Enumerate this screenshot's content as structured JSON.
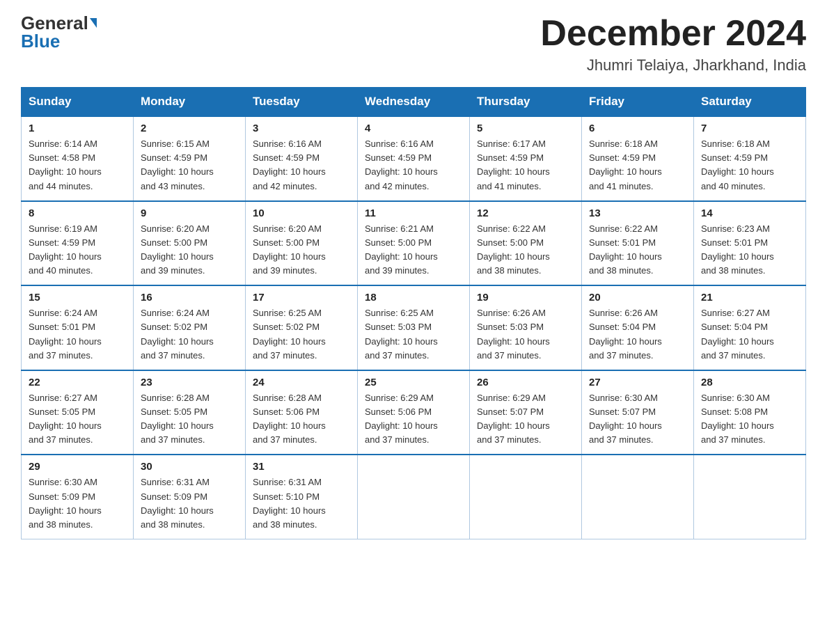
{
  "header": {
    "logo_general": "General",
    "logo_blue": "Blue",
    "month_title": "December 2024",
    "location": "Jhumri Telaiya, Jharkhand, India"
  },
  "days_of_week": [
    "Sunday",
    "Monday",
    "Tuesday",
    "Wednesday",
    "Thursday",
    "Friday",
    "Saturday"
  ],
  "weeks": [
    [
      {
        "num": "1",
        "sunrise": "6:14 AM",
        "sunset": "4:58 PM",
        "daylight": "10 hours and 44 minutes."
      },
      {
        "num": "2",
        "sunrise": "6:15 AM",
        "sunset": "4:59 PM",
        "daylight": "10 hours and 43 minutes."
      },
      {
        "num": "3",
        "sunrise": "6:16 AM",
        "sunset": "4:59 PM",
        "daylight": "10 hours and 42 minutes."
      },
      {
        "num": "4",
        "sunrise": "6:16 AM",
        "sunset": "4:59 PM",
        "daylight": "10 hours and 42 minutes."
      },
      {
        "num": "5",
        "sunrise": "6:17 AM",
        "sunset": "4:59 PM",
        "daylight": "10 hours and 41 minutes."
      },
      {
        "num": "6",
        "sunrise": "6:18 AM",
        "sunset": "4:59 PM",
        "daylight": "10 hours and 41 minutes."
      },
      {
        "num": "7",
        "sunrise": "6:18 AM",
        "sunset": "4:59 PM",
        "daylight": "10 hours and 40 minutes."
      }
    ],
    [
      {
        "num": "8",
        "sunrise": "6:19 AM",
        "sunset": "4:59 PM",
        "daylight": "10 hours and 40 minutes."
      },
      {
        "num": "9",
        "sunrise": "6:20 AM",
        "sunset": "5:00 PM",
        "daylight": "10 hours and 39 minutes."
      },
      {
        "num": "10",
        "sunrise": "6:20 AM",
        "sunset": "5:00 PM",
        "daylight": "10 hours and 39 minutes."
      },
      {
        "num": "11",
        "sunrise": "6:21 AM",
        "sunset": "5:00 PM",
        "daylight": "10 hours and 39 minutes."
      },
      {
        "num": "12",
        "sunrise": "6:22 AM",
        "sunset": "5:00 PM",
        "daylight": "10 hours and 38 minutes."
      },
      {
        "num": "13",
        "sunrise": "6:22 AM",
        "sunset": "5:01 PM",
        "daylight": "10 hours and 38 minutes."
      },
      {
        "num": "14",
        "sunrise": "6:23 AM",
        "sunset": "5:01 PM",
        "daylight": "10 hours and 38 minutes."
      }
    ],
    [
      {
        "num": "15",
        "sunrise": "6:24 AM",
        "sunset": "5:01 PM",
        "daylight": "10 hours and 37 minutes."
      },
      {
        "num": "16",
        "sunrise": "6:24 AM",
        "sunset": "5:02 PM",
        "daylight": "10 hours and 37 minutes."
      },
      {
        "num": "17",
        "sunrise": "6:25 AM",
        "sunset": "5:02 PM",
        "daylight": "10 hours and 37 minutes."
      },
      {
        "num": "18",
        "sunrise": "6:25 AM",
        "sunset": "5:03 PM",
        "daylight": "10 hours and 37 minutes."
      },
      {
        "num": "19",
        "sunrise": "6:26 AM",
        "sunset": "5:03 PM",
        "daylight": "10 hours and 37 minutes."
      },
      {
        "num": "20",
        "sunrise": "6:26 AM",
        "sunset": "5:04 PM",
        "daylight": "10 hours and 37 minutes."
      },
      {
        "num": "21",
        "sunrise": "6:27 AM",
        "sunset": "5:04 PM",
        "daylight": "10 hours and 37 minutes."
      }
    ],
    [
      {
        "num": "22",
        "sunrise": "6:27 AM",
        "sunset": "5:05 PM",
        "daylight": "10 hours and 37 minutes."
      },
      {
        "num": "23",
        "sunrise": "6:28 AM",
        "sunset": "5:05 PM",
        "daylight": "10 hours and 37 minutes."
      },
      {
        "num": "24",
        "sunrise": "6:28 AM",
        "sunset": "5:06 PM",
        "daylight": "10 hours and 37 minutes."
      },
      {
        "num": "25",
        "sunrise": "6:29 AM",
        "sunset": "5:06 PM",
        "daylight": "10 hours and 37 minutes."
      },
      {
        "num": "26",
        "sunrise": "6:29 AM",
        "sunset": "5:07 PM",
        "daylight": "10 hours and 37 minutes."
      },
      {
        "num": "27",
        "sunrise": "6:30 AM",
        "sunset": "5:07 PM",
        "daylight": "10 hours and 37 minutes."
      },
      {
        "num": "28",
        "sunrise": "6:30 AM",
        "sunset": "5:08 PM",
        "daylight": "10 hours and 37 minutes."
      }
    ],
    [
      {
        "num": "29",
        "sunrise": "6:30 AM",
        "sunset": "5:09 PM",
        "daylight": "10 hours and 38 minutes."
      },
      {
        "num": "30",
        "sunrise": "6:31 AM",
        "sunset": "5:09 PM",
        "daylight": "10 hours and 38 minutes."
      },
      {
        "num": "31",
        "sunrise": "6:31 AM",
        "sunset": "5:10 PM",
        "daylight": "10 hours and 38 minutes."
      },
      null,
      null,
      null,
      null
    ]
  ],
  "labels": {
    "sunrise": "Sunrise:",
    "sunset": "Sunset:",
    "daylight": "Daylight:"
  }
}
